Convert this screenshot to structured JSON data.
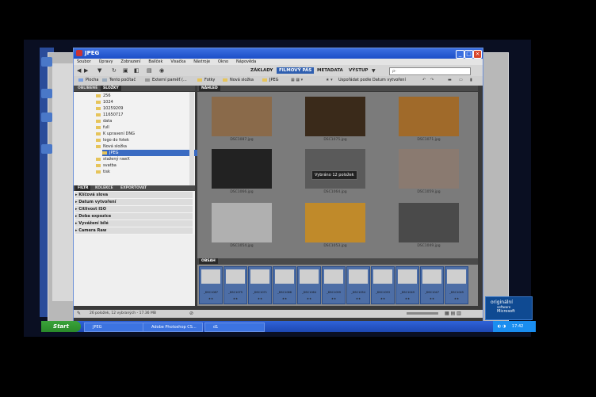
{
  "window": {
    "title": "JPEG"
  },
  "menu": [
    "Soubor",
    "Úpravy",
    "Zobrazení",
    "Balíček",
    "Visačka",
    "Nástroje",
    "Okno",
    "Nápověda"
  ],
  "workspaces": [
    "ZÁKLADY",
    "FILMOVÝ PÁS",
    "METADATA",
    "VÝSTUP"
  ],
  "active_workspace": "FILMOVÝ PÁS",
  "search": {
    "placeholder": "ρ-"
  },
  "breadcrumb": [
    "Plocha",
    "Tento počítač",
    "Externí paměť (...",
    "Fotky",
    "Nová složka",
    "JPEG"
  ],
  "sort_label": "Uspořádat podle Datum vytvoření",
  "left_tabs": [
    "OBLÍBENÉ",
    "SLOŽKY"
  ],
  "folders": [
    "256",
    "1024",
    "10259209",
    "11650717",
    "data",
    "full",
    "K upravení DNG",
    "logo do fotek",
    "Nová složka",
    "JPEG",
    "stažený rawX",
    "svatba",
    "tisk"
  ],
  "selected_folder": "JPEG",
  "filter_tabs": [
    "FILTR",
    "KOLEKCE",
    "EXPORTOVAT"
  ],
  "filters": [
    "Klíčová slova",
    "Datum vytvoření",
    "Citlivost ISO",
    "Doba expozice",
    "Vyvážení bílé",
    "Camera Raw"
  ],
  "preview_header": "NÁHLED",
  "thumbnails": [
    {
      "label": "DSC1087.jpg",
      "tone": "#8a6a4a"
    },
    {
      "label": "DSC1075.jpg",
      "tone": "#3a2a1a"
    },
    {
      "label": "DSC1071.jpg",
      "tone": "#a06a2a"
    },
    {
      "label": "DSC1066.jpg",
      "tone": "#222222"
    },
    {
      "label": "DSC1064.jpg",
      "tone": "#5a5a5a"
    },
    {
      "label": "DSC1059.jpg",
      "tone": "#8a7a70"
    },
    {
      "label": "DSC1054.jpg",
      "tone": "#b0b0b0"
    },
    {
      "label": "DSC1053.jpg",
      "tone": "#c08a2a"
    },
    {
      "label": "DSC1049.jpg",
      "tone": "#4a4a4a"
    }
  ],
  "tooltip": "Vybráno 12 položek",
  "content_header": "OBSAH",
  "filmstrip": [
    {
      "label": "_DSC1087",
      "rating": "★★"
    },
    {
      "label": "_DSC1075",
      "rating": "★★"
    },
    {
      "label": "_DSC1071",
      "rating": "★★"
    },
    {
      "label": "_DSC1066",
      "rating": "★★"
    },
    {
      "label": "_DSC1064",
      "rating": "★★"
    },
    {
      "label": "_DSC1059",
      "rating": "★★"
    },
    {
      "label": "_DSC1054",
      "rating": "★★"
    },
    {
      "label": "_DSC1053",
      "rating": "★★"
    },
    {
      "label": "_DSC1049",
      "rating": "★★"
    },
    {
      "label": "_DSC1047",
      "rating": "★★"
    },
    {
      "label": "_DSC1045",
      "rating": "★★"
    }
  ],
  "status_text": "26 položek, 12 vybraných - 17.36 MB",
  "taskbar": {
    "start": "Start",
    "tasks": [
      "JPEG",
      "Adobe Photoshop CS...",
      "d1"
    ],
    "clock": "17:42"
  },
  "badge": {
    "line1": "originální",
    "line2": "software",
    "line3": "Microsoft"
  },
  "colors": {
    "accent": "#2f5fb0",
    "taskbar": "#2f63d8",
    "start": "#3aa33a"
  }
}
